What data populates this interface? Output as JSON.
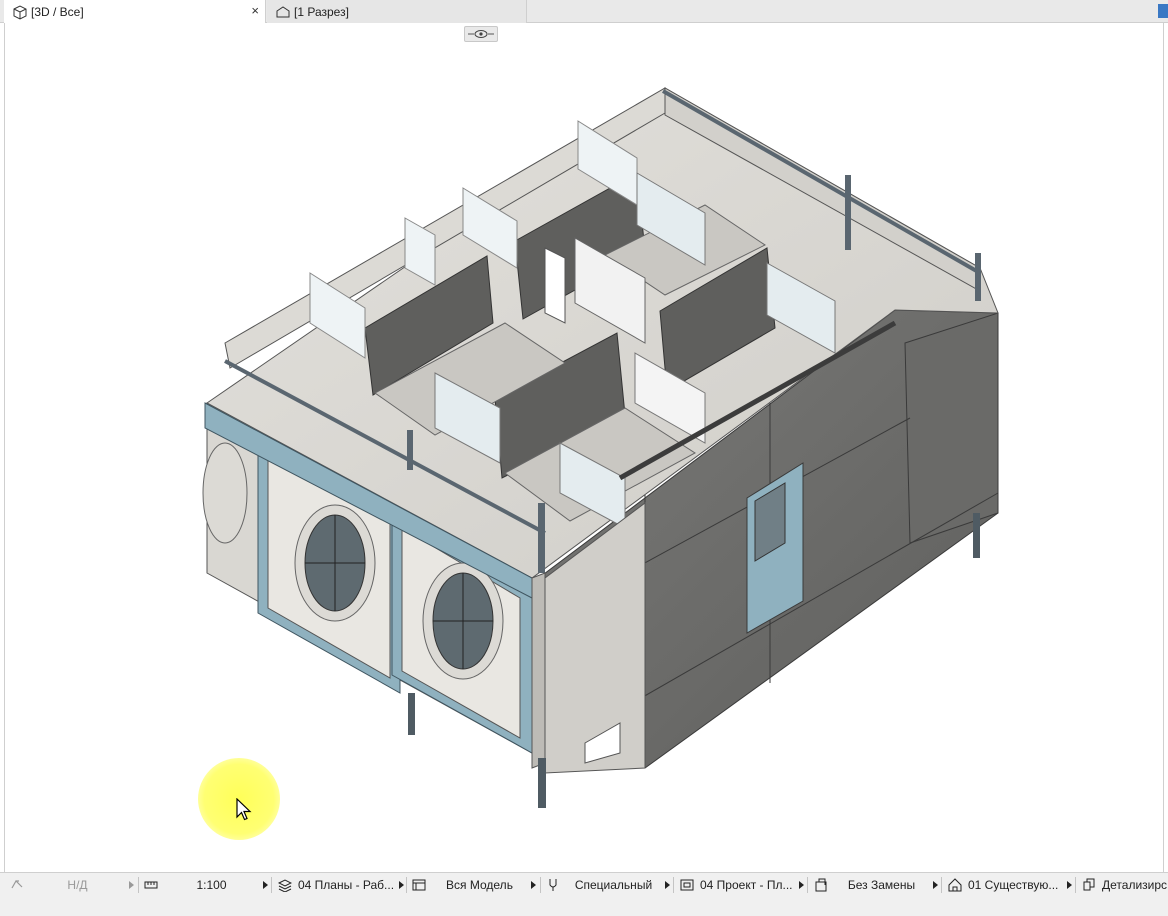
{
  "tabs": [
    {
      "label": "[3D / Все]",
      "icon": "cube-icon",
      "active": true
    },
    {
      "label": "[1 Разрез]",
      "icon": "section-icon",
      "active": false
    }
  ],
  "tab_close": "×",
  "statusbar": {
    "undo": {
      "label": "Н/Д",
      "icon": "redo-icon"
    },
    "scale": {
      "label": "1:100",
      "icon": "ruler-icon"
    },
    "layers": {
      "label": "04 Планы - Раб...",
      "icon": "layers-icon"
    },
    "model_view": {
      "label": "Вся Модель",
      "icon": "model-view-icon"
    },
    "pen_set": {
      "label": "Специальный",
      "icon": "pen-icon"
    },
    "mvo": {
      "label": "04 Проект - Пл...",
      "icon": "display-options-icon"
    },
    "override": {
      "label": "Без Замены",
      "icon": "graphic-override-icon"
    },
    "renovation": {
      "label": "01 Существую...",
      "icon": "renovation-icon"
    },
    "detail": {
      "label": "Детализирс",
      "icon": "detail-icon"
    }
  },
  "colors": {
    "concrete": "#d9d7d2",
    "dark_wall": "#6f6f6d",
    "blue_frame": "#8fb1bf",
    "glass": "#e4ecef",
    "cursor_highlight": "#ffff55"
  }
}
